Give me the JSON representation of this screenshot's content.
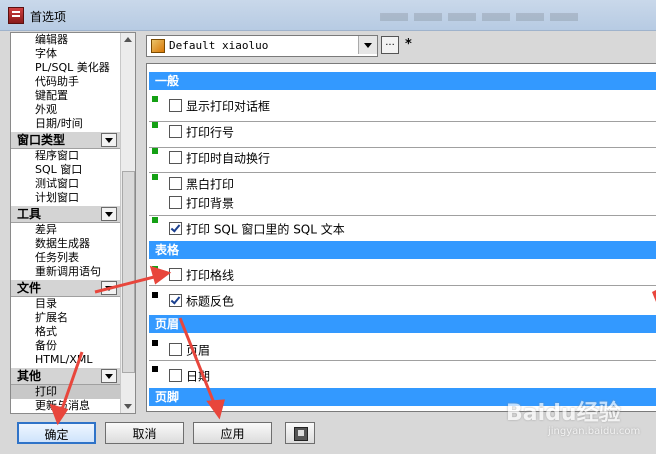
{
  "window": {
    "title": "首选项"
  },
  "tree": {
    "items_top": [
      "编辑器",
      "字体",
      "PL/SQL 美化器",
      "代码助手",
      "键配置",
      "外观",
      "日期/时间"
    ],
    "groups": [
      {
        "label": "窗口类型",
        "items": [
          "程序窗口",
          "SQL 窗口",
          "测试窗口",
          "计划窗口"
        ]
      },
      {
        "label": "工具",
        "items": [
          "差异",
          "数据生成器",
          "任务列表",
          "重新调用语句"
        ]
      },
      {
        "label": "文件",
        "items": [
          "目录",
          "扩展名",
          "格式",
          "备份",
          "HTML/XML"
        ]
      },
      {
        "label": "其他",
        "items": [
          "打印",
          "更新与消息"
        ]
      }
    ],
    "selected": "打印"
  },
  "profile": {
    "value": "Default xiaoluo",
    "more_label": "...",
    "modified_indicator": "*"
  },
  "sections": {
    "general": "一般",
    "grid": "表格",
    "header": "页眉",
    "footer": "页脚"
  },
  "options": {
    "show_print_dialog": {
      "label": "显示打印对话框",
      "checked": false
    },
    "print_line_numbers": {
      "label": "打印行号",
      "checked": false
    },
    "auto_wrap": {
      "label": "打印时自动换行",
      "checked": false
    },
    "black_white": {
      "label": "黑白打印",
      "checked": false
    },
    "print_background": {
      "label": "打印背景",
      "checked": false
    },
    "print_sql_text": {
      "label": "打印 SQL 窗口里的 SQL 文本",
      "checked": true
    },
    "print_grid_lines": {
      "label": "打印格线",
      "checked": false
    },
    "invert_title": {
      "label": "标题反色",
      "checked": true
    },
    "header_page": {
      "label": "页眉",
      "checked": false
    },
    "header_date": {
      "label": "日期",
      "checked": false
    }
  },
  "buttons": {
    "ok": "确定",
    "cancel": "取消",
    "apply": "应用"
  },
  "watermark": {
    "brand": "Baidu经验",
    "url": "jingyan.baidu.com"
  },
  "colors": {
    "section_header": "#3399ff",
    "marker_green": "#14a014",
    "annotation_arrow": "#e8463c"
  },
  "icons": {
    "app": "app-icon",
    "profile": "profile-icon",
    "tool": "tool-icon"
  }
}
